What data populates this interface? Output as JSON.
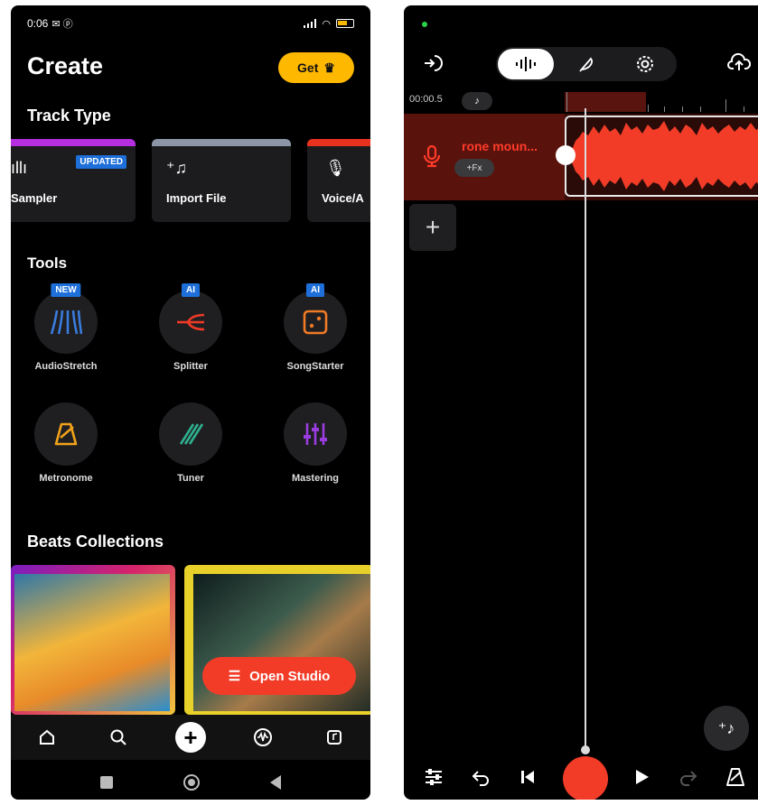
{
  "left": {
    "status": {
      "time": "0:06",
      "battery_icon": "battery-icon"
    },
    "title": "Create",
    "get_button": "Get",
    "track_type_title": "Track Type",
    "track_types": [
      {
        "label": "Sampler",
        "badge": "UPDATED",
        "color": "#b52ee0"
      },
      {
        "label": "Import File",
        "color": "#8d96a6"
      },
      {
        "label": "Voice/A",
        "color": "#e8321e"
      }
    ],
    "tools_title": "Tools",
    "tools": [
      {
        "label": "AudioStretch",
        "tag": "NEW",
        "color": "#3a7de0"
      },
      {
        "label": "Splitter",
        "tag": "AI",
        "color": "#ef3a26"
      },
      {
        "label": "SongStarter",
        "tag": "AI",
        "color": "#f07a25"
      },
      {
        "label": "Metronome",
        "color": "#f0a21a"
      },
      {
        "label": "Tuner",
        "color": "#2fb08e"
      },
      {
        "label": "Mastering",
        "color": "#9b3ce0"
      }
    ],
    "beats_title": "Beats Collections",
    "open_studio": "Open Studio"
  },
  "right": {
    "time_label": "00:00.5",
    "track_name": "rone moun...",
    "fx_label": "+Fx",
    "accent": "#f23c28"
  }
}
